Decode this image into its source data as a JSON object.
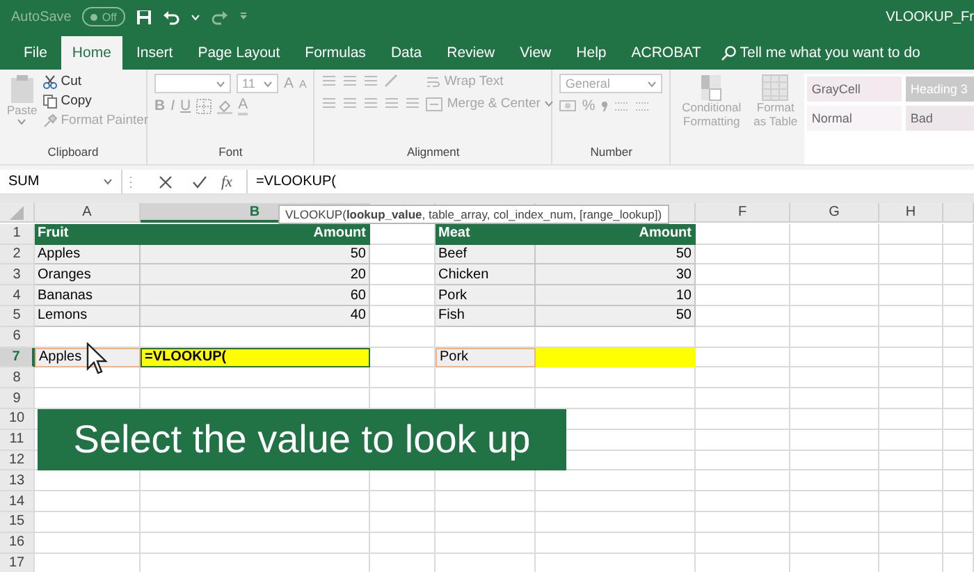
{
  "title_bar": {
    "autosave": {
      "label": "AutoSave",
      "toggle": "Off",
      "on": false
    },
    "title": "VLOOKUP_Fr"
  },
  "tabs": [
    {
      "label": "File",
      "selected": false
    },
    {
      "label": "Home",
      "selected": true
    },
    {
      "label": "Insert",
      "selected": false
    },
    {
      "label": "Page Layout",
      "selected": false
    },
    {
      "label": "Formulas",
      "selected": false
    },
    {
      "label": "Data",
      "selected": false
    },
    {
      "label": "Review",
      "selected": false
    },
    {
      "label": "View",
      "selected": false
    },
    {
      "label": "Help",
      "selected": false
    },
    {
      "label": "ACROBAT",
      "selected": false
    }
  ],
  "tell_me": {
    "placeholder": "Tell me what you want to do"
  },
  "ribbon": {
    "clipboard": {
      "label": "Clipboard",
      "paste": "Paste",
      "items": [
        {
          "label": "Cut",
          "disabled": false
        },
        {
          "label": "Copy",
          "disabled": false
        },
        {
          "label": "Format Painter",
          "disabled": true
        }
      ]
    },
    "font": {
      "label": "Font",
      "size": "11",
      "grow": "A",
      "shrink": "A",
      "bold": "B",
      "italic": "I",
      "underline": "U",
      "font_color": "A"
    },
    "alignment": {
      "label": "Alignment",
      "wrap": "Wrap Text",
      "merge": "Merge & Center"
    },
    "number": {
      "label": "Number",
      "format": "General",
      "percent": "%"
    },
    "buttons": [
      {
        "label": "Conditional Formatting"
      },
      {
        "label": "Format as Table"
      }
    ],
    "styles": [
      {
        "label": "GrayCell",
        "color": "#f3eaf0"
      },
      {
        "label": "Heading 3",
        "color": "#c9c9c9"
      },
      {
        "label": "Normal",
        "color": "#f7f3f6"
      },
      {
        "label": "Bad",
        "color": "#ede7eb"
      }
    ]
  },
  "formula_bar": {
    "name_box": "SUM",
    "fx": "fx",
    "formula": "=VLOOKUP("
  },
  "tooltip": "VLOOKUP(**lookup_value**, table_array, col_index_num, [range_lookup])",
  "sheet": {
    "columns": [
      {
        "label": "A",
        "selected": false
      },
      {
        "label": "B",
        "selected": true
      },
      {
        "selected": false
      },
      {
        "selected": false
      },
      {
        "selected": false
      },
      {
        "label": "F",
        "selected": false
      },
      {
        "label": "G",
        "selected": false
      },
      {
        "label": "H",
        "selected": false
      }
    ],
    "rows": [
      {
        "number": "1",
        "selected": false,
        "cells": [
          {
            "kind": "header",
            "text": "Fruit"
          },
          {
            "kind": "header-number",
            "text": "Amount"
          },
          {
            "kind": "blank"
          },
          {
            "kind": "header",
            "text": "Meat"
          },
          {
            "kind": "header-number",
            "text": "Amount"
          }
        ]
      },
      {
        "number": "2",
        "selected": false,
        "cells": [
          {
            "kind": "text",
            "text": "Apples"
          },
          {
            "kind": "number",
            "text": "50"
          },
          {
            "kind": "blank"
          },
          {
            "kind": "text",
            "text": "Beef"
          },
          {
            "kind": "number",
            "text": "50"
          }
        ]
      },
      {
        "number": "3",
        "selected": false,
        "cells": [
          {
            "kind": "text",
            "text": "Oranges"
          },
          {
            "kind": "number",
            "text": "20"
          },
          {
            "kind": "blank"
          },
          {
            "kind": "text",
            "text": "Chicken"
          },
          {
            "kind": "number",
            "text": "30"
          }
        ]
      },
      {
        "number": "4",
        "selected": false,
        "cells": [
          {
            "kind": "text",
            "text": "Bananas"
          },
          {
            "kind": "number",
            "text": "60"
          },
          {
            "kind": "blank"
          },
          {
            "kind": "text",
            "text": "Pork"
          },
          {
            "kind": "number",
            "text": "10"
          }
        ]
      },
      {
        "number": "5",
        "selected": false,
        "cells": [
          {
            "kind": "text",
            "text": "Lemons"
          },
          {
            "kind": "number",
            "text": "40"
          },
          {
            "kind": "blank"
          },
          {
            "kind": "text",
            "text": "Fish"
          },
          {
            "kind": "number",
            "text": "50"
          }
        ]
      },
      {
        "number": "6",
        "selected": false
      },
      {
        "number": "7",
        "selected": true,
        "cells": [
          {
            "kind": "lookup",
            "text": "Apples"
          },
          {
            "kind": "active",
            "text": "=VLOOKUP("
          },
          {
            "kind": "blank"
          },
          {
            "kind": "lookup",
            "text": "Pork"
          },
          {
            "kind": "result"
          }
        ]
      },
      {
        "number": "8",
        "selected": false
      },
      {
        "number": "9",
        "selected": false
      },
      {
        "number": "10",
        "selected": false
      },
      {
        "number": "11",
        "selected": false
      },
      {
        "number": "12",
        "selected": false
      },
      {
        "number": "13",
        "selected": false
      },
      {
        "number": "14",
        "selected": false
      },
      {
        "number": "15",
        "selected": false
      },
      {
        "number": "16",
        "selected": false
      },
      {
        "number": "17",
        "selected": false
      }
    ]
  },
  "caption": "Select the value to look up"
}
